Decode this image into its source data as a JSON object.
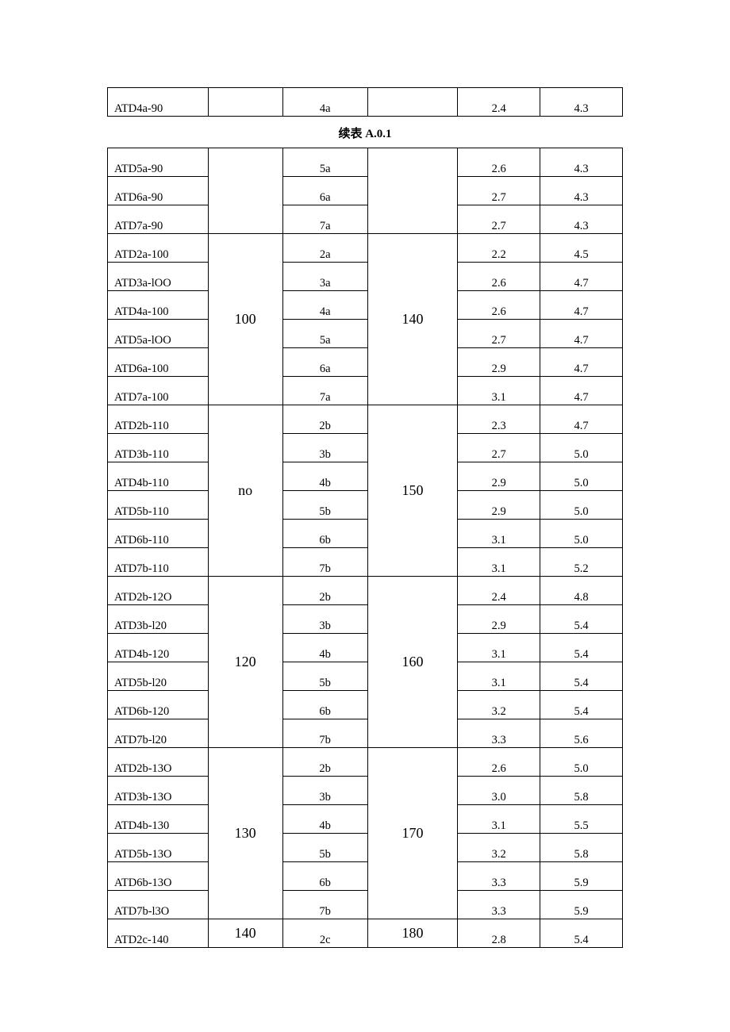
{
  "caption": "续表 A.0.1",
  "table1": {
    "rows": [
      {
        "c1": "ATD4a-90",
        "c2": "",
        "c3": "4a",
        "c4": "",
        "c5": "2.4",
        "c6": "4.3"
      }
    ]
  },
  "table2": {
    "groups": [
      {
        "c2": "",
        "c4": "",
        "rows": [
          {
            "c1": "ATD5a-90",
            "c3": "5a",
            "c5": "2.6",
            "c6": "4.3"
          },
          {
            "c1": "ATD6a-90",
            "c3": "6a",
            "c5": "2.7",
            "c6": "4.3"
          },
          {
            "c1": "ATD7a-90",
            "c3": "7a",
            "c5": "2.7",
            "c6": "4.3"
          }
        ]
      },
      {
        "c2": "100",
        "c4": "140",
        "rows": [
          {
            "c1": "ATD2a-100",
            "c3": "2a",
            "c5": "2.2",
            "c6": "4.5"
          },
          {
            "c1": "ATD3a-lOO",
            "c3": "3a",
            "c5": "2.6",
            "c6": "4.7"
          },
          {
            "c1": "ATD4a-100",
            "c3": "4a",
            "c5": "2.6",
            "c6": "4.7"
          },
          {
            "c1": "ATD5a-lOO",
            "c3": "5a",
            "c5": "2.7",
            "c6": "4.7"
          },
          {
            "c1": "ATD6a-100",
            "c3": "6a",
            "c5": "2.9",
            "c6": "4.7"
          },
          {
            "c1": "ATD7a-100",
            "c3": "7a",
            "c5": "3.1",
            "c6": "4.7"
          }
        ]
      },
      {
        "c2": "no",
        "c4": "150",
        "rows": [
          {
            "c1": "ATD2b-110",
            "c3": "2b",
            "c5": "2.3",
            "c6": "4.7"
          },
          {
            "c1": "ATD3b-110",
            "c3": "3b",
            "c5": "2.7",
            "c6": "5.0"
          },
          {
            "c1": "ATD4b-110",
            "c3": "4b",
            "c5": "2.9",
            "c6": "5.0"
          },
          {
            "c1": "ATD5b-110",
            "c3": "5b",
            "c5": "2.9",
            "c6": "5.0"
          },
          {
            "c1": "ATD6b-110",
            "c3": "6b",
            "c5": "3.1",
            "c6": "5.0"
          },
          {
            "c1": "ATD7b-110",
            "c3": "7b",
            "c5": "3.1",
            "c6": "5.2"
          }
        ]
      },
      {
        "c2": "120",
        "c4": "160",
        "rows": [
          {
            "c1": "ATD2b-12O",
            "c3": "2b",
            "c5": "2.4",
            "c6": "4.8"
          },
          {
            "c1": "ATD3b-l20",
            "c3": "3b",
            "c5": "2.9",
            "c6": "5.4"
          },
          {
            "c1": "ATD4b-120",
            "c3": "4b",
            "c5": "3.1",
            "c6": "5.4"
          },
          {
            "c1": "ATD5b-l20",
            "c3": "5b",
            "c5": "3.1",
            "c6": "5.4"
          },
          {
            "c1": "ATD6b-120",
            "c3": "6b",
            "c5": "3.2",
            "c6": "5.4"
          },
          {
            "c1": "ATD7b-l20",
            "c3": "7b",
            "c5": "3.3",
            "c6": "5.6"
          }
        ]
      },
      {
        "c2": "130",
        "c4": "170",
        "rows": [
          {
            "c1": "ATD2b-13O",
            "c3": "2b",
            "c5": "2.6",
            "c6": "5.0"
          },
          {
            "c1": "ATD3b-13O",
            "c3": "3b",
            "c5": "3.0",
            "c6": "5.8"
          },
          {
            "c1": "ATD4b-130",
            "c3": "4b",
            "c5": "3.1",
            "c6": "5.5"
          },
          {
            "c1": "ATD5b-13O",
            "c3": "5b",
            "c5": "3.2",
            "c6": "5.8"
          },
          {
            "c1": "ATD6b-13O",
            "c3": "6b",
            "c5": "3.3",
            "c6": "5.9"
          },
          {
            "c1": "ATD7b-l3O",
            "c3": "7b",
            "c5": "3.3",
            "c6": "5.9"
          }
        ]
      },
      {
        "c2": "140",
        "c4": "180",
        "rows": [
          {
            "c1": "ATD2c-140",
            "c3": "2c",
            "c5": "2.8",
            "c6": "5.4"
          }
        ]
      }
    ]
  }
}
